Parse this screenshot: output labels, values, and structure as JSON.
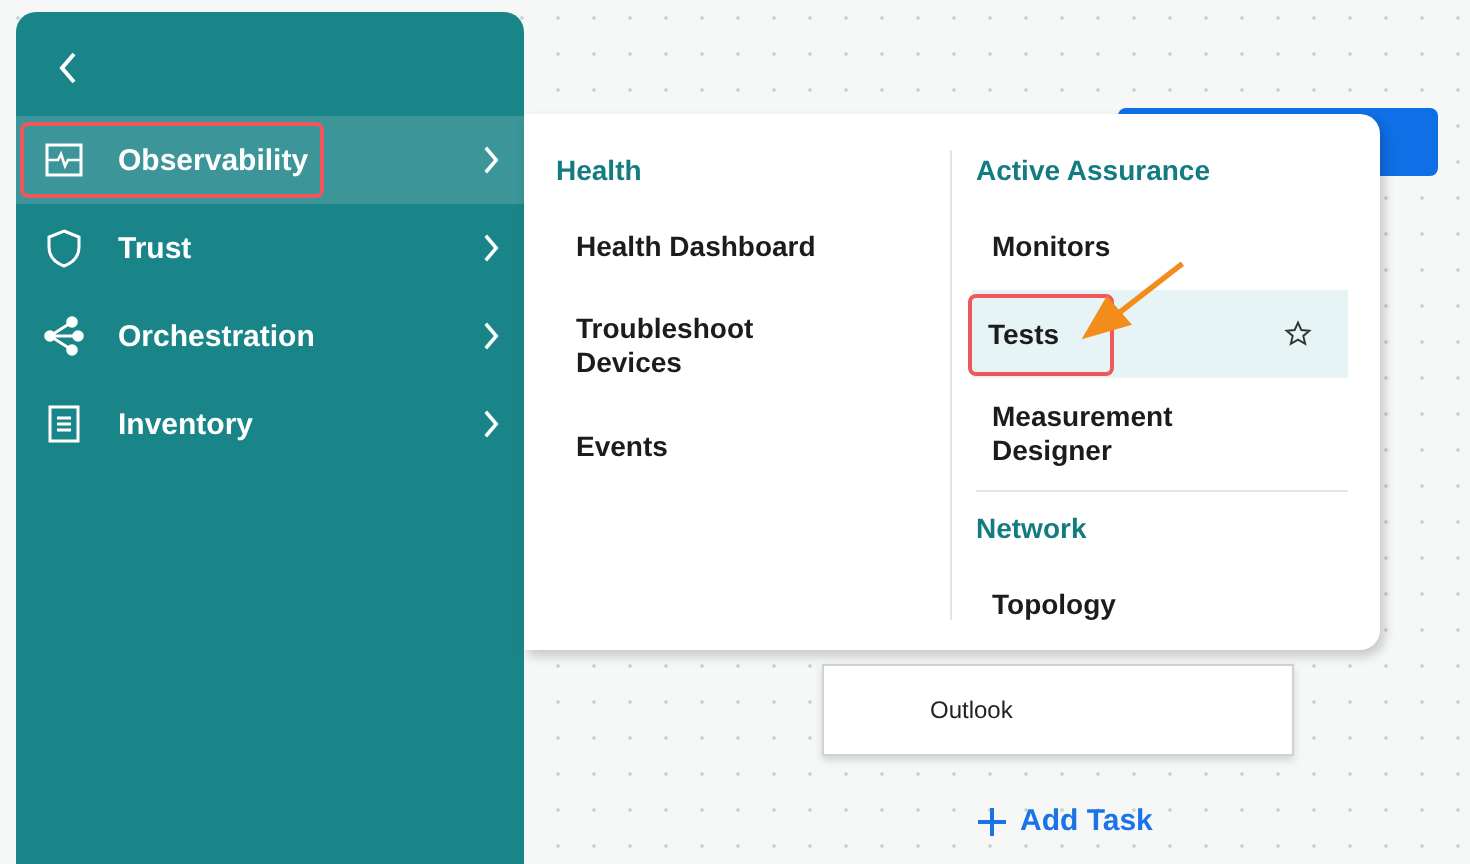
{
  "sidebar": {
    "items": [
      {
        "label": "Observability",
        "selected": true,
        "annotated": true
      },
      {
        "label": "Trust",
        "selected": false,
        "annotated": false
      },
      {
        "label": "Orchestration",
        "selected": false,
        "annotated": false
      },
      {
        "label": "Inventory",
        "selected": false,
        "annotated": false
      }
    ]
  },
  "flyout": {
    "columns": [
      {
        "sections": [
          {
            "title": "Health",
            "items": [
              {
                "label": "Health Dashboard",
                "selected": false,
                "annotated": false
              },
              {
                "label": "Troubleshoot Devices",
                "selected": false,
                "annotated": false
              },
              {
                "label": "Events",
                "selected": false,
                "annotated": false
              }
            ]
          }
        ]
      },
      {
        "sections": [
          {
            "title": "Active Assurance",
            "items": [
              {
                "label": "Monitors",
                "selected": false,
                "annotated": false
              },
              {
                "label": "Tests",
                "selected": true,
                "annotated": true
              },
              {
                "label": "Measurement Designer",
                "selected": false,
                "annotated": false
              }
            ]
          },
          {
            "title": "Network",
            "items": [
              {
                "label": "Topology",
                "selected": false,
                "annotated": false
              }
            ]
          }
        ]
      }
    ]
  },
  "canvas": {
    "task_card": "Outlook",
    "add_task": "Add Task"
  }
}
